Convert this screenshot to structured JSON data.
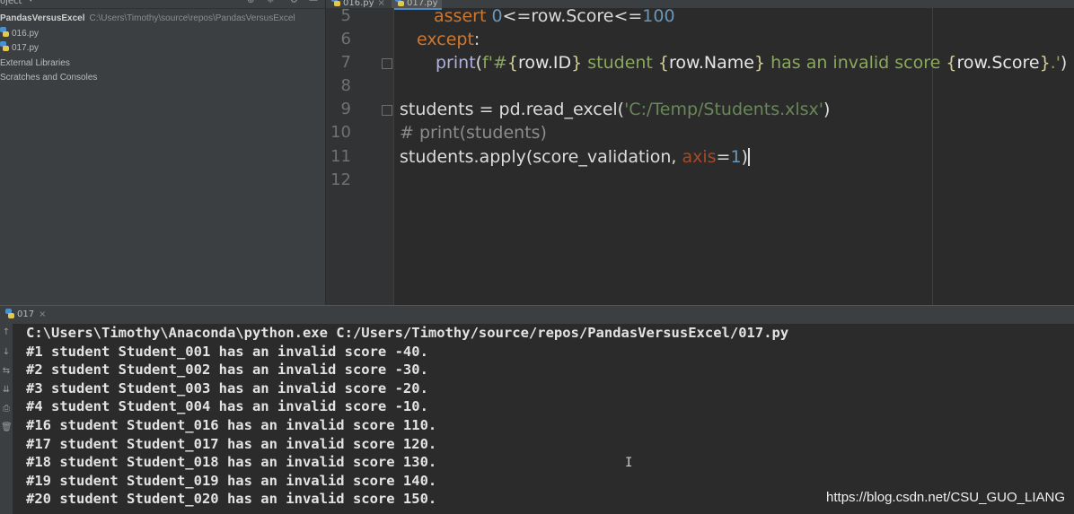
{
  "project_panel": {
    "title": "oject",
    "root": {
      "name": "PandasVersusExcel",
      "path": "C:\\Users\\Timothy\\source\\repos\\PandasVersusExcel"
    },
    "files": [
      "016.py",
      "017.py"
    ],
    "external_libraries": "External Libraries",
    "scratches": "Scratches and Consoles"
  },
  "editor": {
    "tabs": [
      {
        "label": "016.py",
        "active": false
      },
      {
        "label": "017.py",
        "active": true
      }
    ],
    "line_numbers": [
      "5",
      "6",
      "7",
      "8",
      "9",
      "10",
      "11",
      "12"
    ],
    "code": {
      "l5_kw": "assert",
      "l5_num": "0",
      "l5_rest": "<=row.Score<=",
      "l5_num2": "100",
      "l6_kw": "except",
      "l6_colon": ":",
      "l7_builtin": "print",
      "l7_open": "(",
      "l7_fprefix": "f'#",
      "l7_b1o": "{",
      "l7_v1": "row.ID",
      "l7_b1c": "}",
      "l7_t1": " student ",
      "l7_b2o": "{",
      "l7_v2": "row.Name",
      "l7_b2c": "}",
      "l7_t2": " has an invalid score ",
      "l7_b3o": "{",
      "l7_v3": "row.Score",
      "l7_b3c": "}",
      "l7_end": ".'",
      "l7_close": ")",
      "l9_a": "students = pd.read_excel(",
      "l9_str": "'C:/Temp/Students.xlsx'",
      "l9_b": ")",
      "l10_comment": "# print(students)",
      "l11_a": "students.apply(score_validation, ",
      "l11_param": "axis",
      "l11_eq": "=",
      "l11_num": "1",
      "l11_b": ")"
    }
  },
  "run_panel": {
    "tab_label": "017",
    "output": [
      "C:\\Users\\Timothy\\Anaconda\\python.exe C:/Users/Timothy/source/repos/PandasVersusExcel/017.py",
      "#1 student Student_001 has an invalid score -40.",
      "#2 student Student_002 has an invalid score -30.",
      "#3 student Student_003 has an invalid score -20.",
      "#4 student Student_004 has an invalid score -10.",
      "#16 student Student_016 has an invalid score 110.",
      "#17 student Student_017 has an invalid score 120.",
      "#18 student Student_018 has an invalid score 130.",
      "#19 student Student_019 has an invalid score 140.",
      "#20 student Student_020 has an invalid score 150."
    ]
  },
  "watermark": "https://blog.csdn.net/CSU_GUO_LIANG",
  "colors": {
    "keyword": "#cc7832",
    "number": "#6897bb",
    "string": "#6a8759",
    "comment": "#8c8c8c",
    "background": "#2b2b2b",
    "panel": "#3c3f41"
  }
}
